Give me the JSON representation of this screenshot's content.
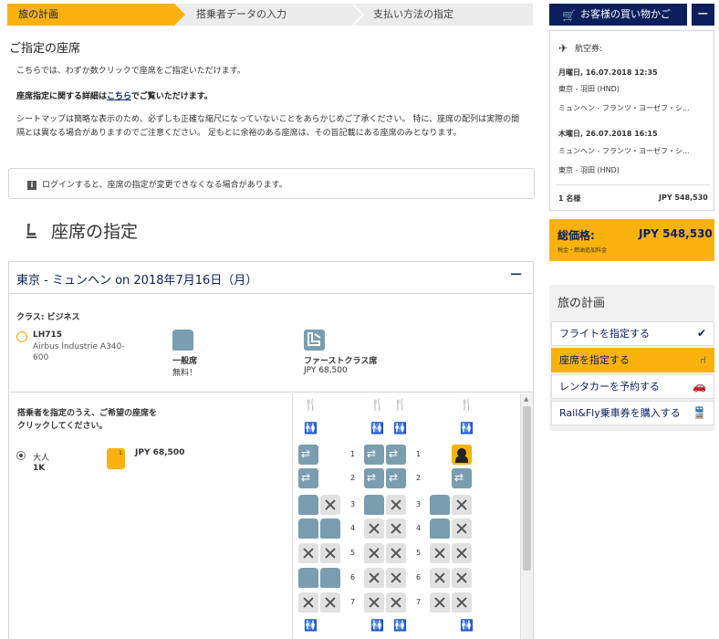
{
  "steps": {
    "s1": "旅の計画",
    "s2": "搭乗者データの入力",
    "s3": "支払い方法の指定"
  },
  "intro": {
    "heading": "ご指定の座席",
    "p1": "こちらでは、わずか数クリックで座席をご指定いただけます。",
    "p2_before": "座席指定に関する詳細は",
    "p2_link": "こちら",
    "p2_after": "でご覧いただけます。",
    "p3": "シートマップは簡略な表示のため、必ずしも正確な縮尺になっていないことをあらかじめご了承ください。 特に、座席の配列は実際の間隔とは異なる場合がありますのでご注意ください。 足もとに余裕のある座席は、その旨記載にある座席のみとなります。",
    "notice": "ログインすると、座席の指定が変更できなくなる場合があります。",
    "notice_icon": "i"
  },
  "seat_section": {
    "heading": "座席の指定"
  },
  "flight": {
    "title": "東京 - ミュンヘン on 2018年7月16日（月）",
    "collapse": "−",
    "class_label": "クラス: ビジネス",
    "number": "LH715",
    "aircraft": "Airbus Industrie A340-600",
    "legend_economy_label": "一般席",
    "legend_economy_price": "無料！",
    "legend_first_label": "ファーストクラス席",
    "legend_first_price": "JPY 68,500",
    "instruction": "搭乗者を指定のうえ、ご希望の座席をクリックしてください。",
    "passenger_type": "大人",
    "passenger_seat": "1K",
    "passenger_seat_badge": "1",
    "passenger_price": "JPY 68,500"
  },
  "seatmap": {
    "rows": [
      "1",
      "1",
      "2",
      "2",
      "3",
      "3",
      "4",
      "4",
      "5",
      "5",
      "6",
      "6",
      "7",
      "7"
    ]
  },
  "sidebar": {
    "cart_label": "お客様の買い物かご",
    "cart_collapse": "−",
    "air_label": "航空券:",
    "out_date": "月曜日, 16.07.2018 12:35",
    "out_from": "東京 - 羽田 (HND)",
    "out_to": "ミュンヘン - フランツ・ヨーゼフ・シ...",
    "in_date": "木曜日, 26.07.2018 16:15",
    "in_from": "ミュンヘン - フランツ・ヨーゼフ・シ...",
    "in_to": "東京 - 羽田 (HND)",
    "pax_count": "1 名様",
    "pax_price": "JPY 548,530",
    "total_label": "総価格:",
    "total_value": "JPY 548,530",
    "total_sub": "税金・燃油追加料金",
    "plan_title": "旅の計画",
    "plan_items": [
      "フライトを指定する",
      "座席を指定する",
      "レンタカーを予約する",
      "Rail&Fly乗車券を購入する"
    ]
  },
  "colors": {
    "brand_navy": "#0a1f5c",
    "accent_yellow": "#f9b20d",
    "seat_available": "#7a9db0",
    "seat_taken": "#e1e1e1"
  }
}
